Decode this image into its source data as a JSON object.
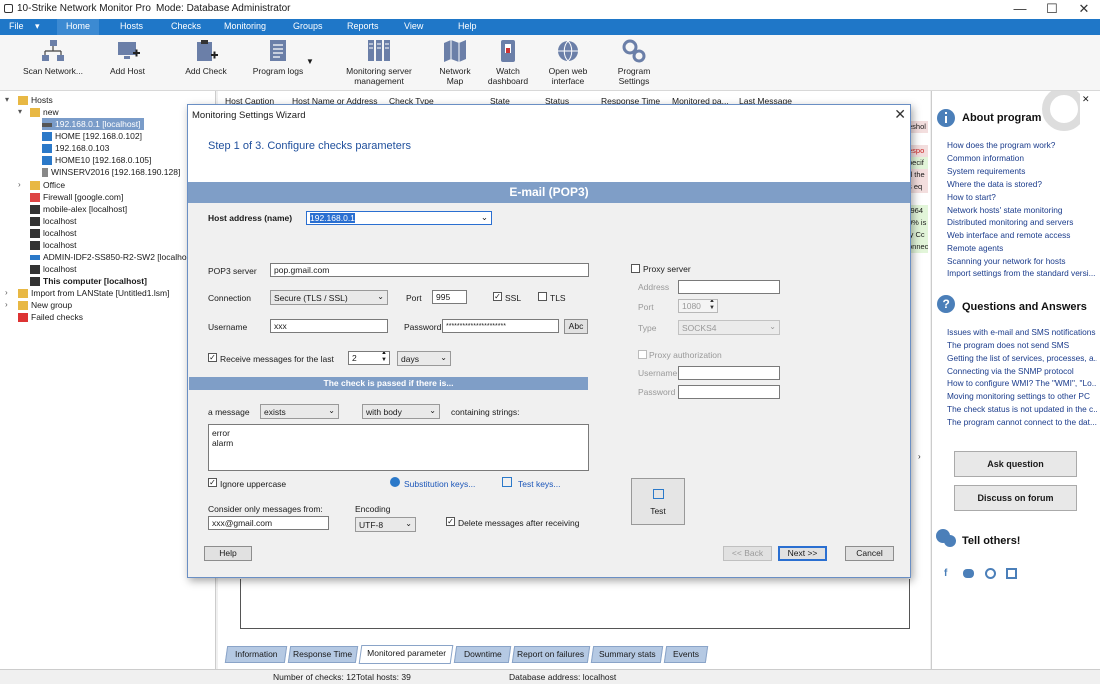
{
  "app": {
    "title": "10-Strike Network Monitor Pro",
    "mode": "Mode: Database Administrator"
  },
  "window_controls": {
    "minimize": "—",
    "maximize": "☐",
    "close": "✕"
  },
  "menu": [
    "File",
    "▾",
    "Home",
    "Hosts",
    "Checks",
    "Monitoring",
    "Groups",
    "Reports",
    "View",
    "Help"
  ],
  "ribbon": [
    {
      "label": "Scan Network...",
      "icon": "scan-network-icon"
    },
    {
      "label": "Add Host",
      "icon": "add-host-icon"
    },
    {
      "label": "Add Check",
      "icon": "add-check-icon"
    },
    {
      "label": "Program logs",
      "icon": "program-logs-icon"
    },
    {
      "label": "Monitoring server\nmanagement",
      "icon": "server-management-icon"
    },
    {
      "label": "Network\nMap",
      "icon": "network-map-icon"
    },
    {
      "label": "Watch\ndashboard",
      "icon": "dashboard-icon"
    },
    {
      "label": "Open web\ninterface",
      "icon": "web-interface-icon"
    },
    {
      "label": "Program\nSettings",
      "icon": "settings-icon"
    }
  ],
  "tree": [
    {
      "label": "Hosts",
      "level": 0,
      "icon": "folder",
      "expanded": true
    },
    {
      "label": "new",
      "level": 1,
      "icon": "folder",
      "expanded": true
    },
    {
      "label": "192.168.0.1 [localhost]",
      "level": 2,
      "icon": "router",
      "selected": true
    },
    {
      "label": "HOME [192.168.0.102]",
      "level": 2,
      "icon": "monitor"
    },
    {
      "label": "192.168.0.103",
      "level": 2,
      "icon": "monitor"
    },
    {
      "label": "HOME10 [192.168.0.105]",
      "level": 2,
      "icon": "monitor"
    },
    {
      "label": "WINSERV2016 [192.168.190.128]",
      "level": 2,
      "icon": "server"
    },
    {
      "label": "Office",
      "level": 1,
      "icon": "folder",
      "collapsed": true
    },
    {
      "label": "Firewall [google.com]",
      "level": 1,
      "icon": "firewall"
    },
    {
      "label": "mobile-alex [localhost]",
      "level": 1,
      "icon": "computer"
    },
    {
      "label": "localhost",
      "level": 1,
      "icon": "computer"
    },
    {
      "label": "localhost",
      "level": 1,
      "icon": "computer"
    },
    {
      "label": "localhost",
      "level": 1,
      "icon": "computer"
    },
    {
      "label": "ADMIN-IDF2-SS850-R2-SW2 [localhost]",
      "level": 1,
      "icon": "switch"
    },
    {
      "label": "localhost",
      "level": 1,
      "icon": "computer"
    },
    {
      "label": "This computer [localhost]",
      "level": 1,
      "icon": "computer",
      "bold": true
    },
    {
      "label": "Import from LANState [Untitled1.lsm]",
      "level": 0,
      "icon": "folder",
      "collapsed": true
    },
    {
      "label": "New group",
      "level": 0,
      "icon": "folder",
      "collapsed": true
    },
    {
      "label": "Failed checks",
      "level": 0,
      "icon": "failed"
    }
  ],
  "grid": {
    "columns": [
      "Host Caption",
      "Host Name or Address",
      "Check Type",
      "State",
      "Status",
      "Response Time",
      "Monitored pa...",
      "Last Message"
    ],
    "side_cells": [
      "eshol",
      "espo",
      "pecif",
      "d the",
      "s eq",
      "(964",
      "0% is",
      "ly Cc",
      "onnec"
    ]
  },
  "bottom_tabs": [
    "Information",
    "Response Time",
    "Monitored parameter",
    "Downtime",
    "Report on failures",
    "Summary stats",
    "Events"
  ],
  "status_bar": {
    "checks": "Number of checks: 12",
    "hosts": "Total hosts: 39",
    "db": "Database address: localhost"
  },
  "about": {
    "title": "About program",
    "links": [
      "How does the program work?",
      "Common information",
      "System requirements",
      "Where the data is stored?",
      "How to start?",
      "Network hosts' state monitoring",
      "Distributed monitoring and servers",
      "Web interface and remote access",
      "Remote agents",
      "Scanning your network for hosts",
      "Import settings from the standard versi..."
    ]
  },
  "qa": {
    "title": "Questions and Answers",
    "links": [
      "Issues with e-mail and SMS notifications",
      "The program does not send SMS",
      "Getting the list of services, processes, a...",
      "Connecting via the SNMP protocol",
      "How to configure WMI? The \"WMI\", \"Lo...",
      "Moving monitoring settings to other PC",
      "The check status is not updated in the c...",
      "The program cannot connect to the dat..."
    ]
  },
  "right_buttons": {
    "ask": "Ask question",
    "forum": "Discuss on forum"
  },
  "tell": {
    "title": "Tell others!",
    "icons": [
      "facebook-icon",
      "twitter-icon",
      "vk-icon",
      "linkedin-icon"
    ]
  },
  "dialog": {
    "title": "Monitoring Settings Wizard",
    "close": "✕",
    "step": "Step 1 of 3. Configure checks parameters",
    "check_type": "E-mail (POP3)",
    "host_label": "Host address (name)",
    "host_value": "192.168.0.1",
    "pop3_label": "POP3 server",
    "pop3_value": "pop.gmail.com",
    "connection_label": "Connection",
    "connection_value": "Secure (TLS / SSL)",
    "port_label": "Port",
    "port_value": "995",
    "ssl_label": "SSL",
    "ssl_checked": true,
    "tls_label": "TLS",
    "tls_checked": false,
    "username_label": "Username",
    "username_value": "xxx",
    "password_label": "Password",
    "password_value": "**********************",
    "abc_label": "Abc",
    "receive_label": "Receive messages for the last",
    "receive_checked": true,
    "receive_value": "2",
    "receive_unit": "days",
    "pass_band": "The check is passed if there is...",
    "message_label": "a message",
    "message_cond": "exists",
    "message_part": "with body",
    "containing_label": "containing strings:",
    "strings": [
      "error",
      "alarm"
    ],
    "ignore_label": "Ignore uppercase",
    "ignore_checked": true,
    "subst_link": "Substitution keys...",
    "testkeys_link": "Test keys...",
    "consider_label": "Consider only messages from:",
    "consider_value": "xxx@gmail.com",
    "encoding_label": "Encoding",
    "encoding_value": "UTF-8",
    "delete_label": "Delete messages after receiving",
    "delete_checked": true,
    "proxy_label": "Proxy server",
    "proxy_address_label": "Address",
    "proxy_port_label": "Port",
    "proxy_port_value": "1080",
    "proxy_type_label": "Type",
    "proxy_type_value": "SOCKS4",
    "proxy_auth_label": "Proxy authorization",
    "proxy_user_label": "Username",
    "proxy_pass_label": "Password",
    "test_label": "Test",
    "help_btn": "Help",
    "back_btn": "<< Back",
    "next_btn": "Next >>",
    "cancel_btn": "Cancel"
  }
}
